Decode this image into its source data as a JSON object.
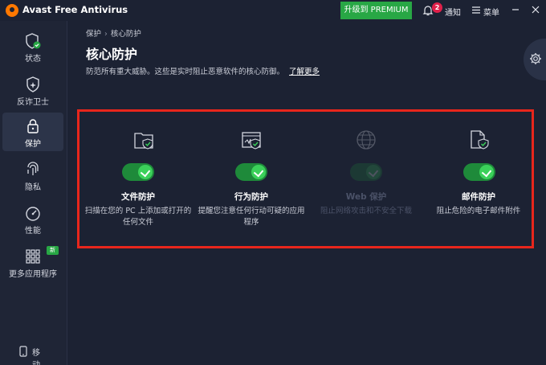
{
  "app": {
    "title": "Avast Free Antivirus"
  },
  "header": {
    "upgrade_label": "升级到 PREMIUM",
    "notifications_label": "通知",
    "notifications_count": "2",
    "menu_label": "菜单"
  },
  "sidebar": {
    "items": [
      {
        "label": "状态"
      },
      {
        "label": "反诈卫士"
      },
      {
        "label": "保护"
      },
      {
        "label": "隐私"
      },
      {
        "label": "性能"
      },
      {
        "label": "更多应用程序"
      }
    ],
    "new_badge": "新",
    "mobile_label": "移动"
  },
  "main": {
    "breadcrumb": [
      "保护",
      "核心防护"
    ],
    "title": "核心防护",
    "subtitle": "防范所有重大威胁。这些是实时阻止恶意软件的核心防御。",
    "learn_more": "了解更多",
    "shields": [
      {
        "name": "文件防护",
        "desc": "扫描在您的 PC 上添加或打开的任何文件",
        "enabled": true
      },
      {
        "name": "行为防护",
        "desc": "提醒您注意任何行动可疑的应用程序",
        "enabled": true
      },
      {
        "name": "Web 保护",
        "desc": "阻止网络攻击和不安全下载",
        "enabled": false
      },
      {
        "name": "邮件防护",
        "desc": "阻止危险的电子邮件附件",
        "enabled": true
      }
    ]
  },
  "colors": {
    "accent": "#28a745",
    "highlight": "#e8261c",
    "background": "#1c2233"
  }
}
